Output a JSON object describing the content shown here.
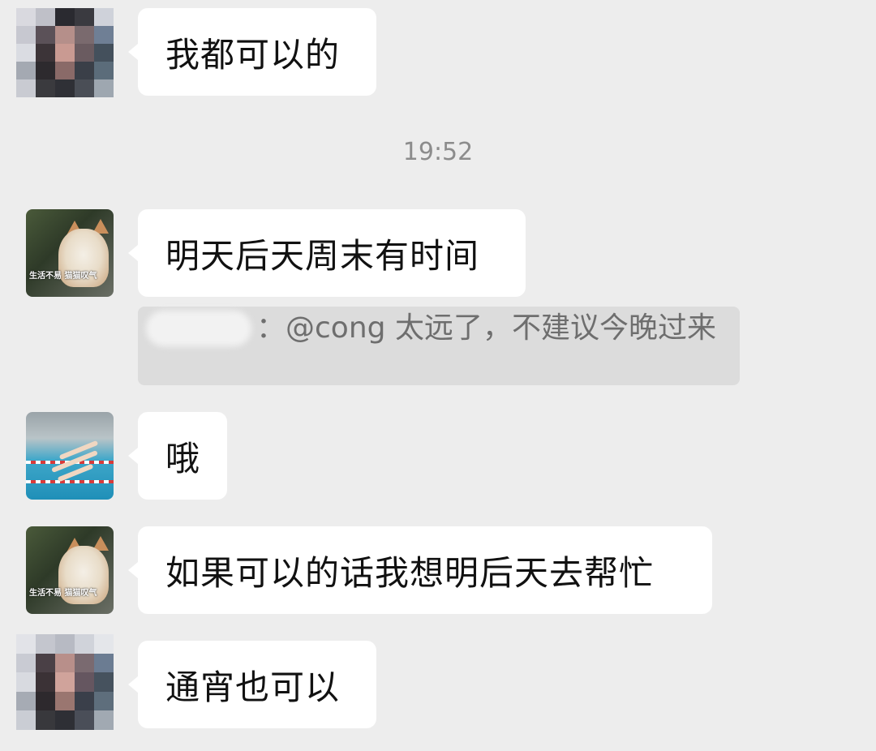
{
  "messages": [
    {
      "id": "m1",
      "avatar": "blurred-person-avatar",
      "text": "我都可以的"
    },
    {
      "id": "m2",
      "avatar": "cat-meme-avatar",
      "text": "明天后天周末有时间"
    },
    {
      "id": "m3",
      "avatar": "swimming-pool-avatar",
      "text": "哦"
    },
    {
      "id": "m4",
      "avatar": "cat-meme-avatar",
      "text": "如果可以的话我想明后天去帮忙"
    },
    {
      "id": "m5",
      "avatar": "blurred-person-avatar",
      "text": "通宵也可以"
    }
  ],
  "timestamp": "19:52",
  "quote": {
    "separator": "：",
    "text": "@cong 太远了，不建议今晚过来"
  },
  "cat_avatar": {
    "caption": "生活不易 猫猫叹气"
  },
  "colors": {
    "background": "#ededed",
    "bubble": "#ffffff",
    "quote_background": "#dcdcdc",
    "timestamp_text": "#8c8c8c"
  }
}
